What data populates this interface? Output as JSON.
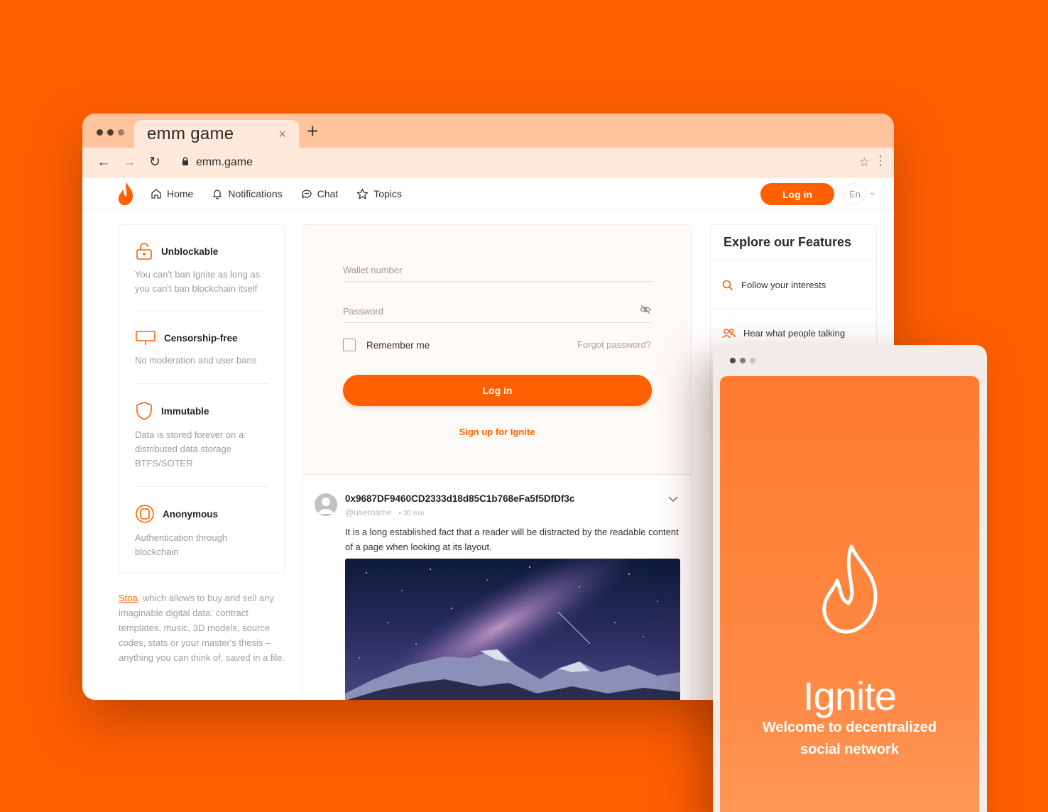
{
  "browser": {
    "tab_title": "emm game",
    "tab_close": "×",
    "new_tab": "+",
    "url": "emm.game"
  },
  "nav": {
    "items": [
      {
        "label": "Home",
        "icon": "home-icon"
      },
      {
        "label": "Notifications",
        "icon": "bell-icon"
      },
      {
        "label": "Chat",
        "icon": "chat-icon"
      },
      {
        "label": "Topics",
        "icon": "star-icon"
      }
    ],
    "login": "Log in",
    "lang": "En"
  },
  "features": [
    {
      "title": "Unblockable",
      "desc": "You can't ban Ignite as long as you can't ban blockchain itself",
      "icon": "padlock-icon"
    },
    {
      "title": "Censorship-free",
      "desc": "No moderation and user bans",
      "icon": "signboard-icon"
    },
    {
      "title": "Immutable",
      "desc": "Data is stored forever on a distributed data storage BTFS/SOTER",
      "icon": "shield-icon"
    },
    {
      "title": "Anonymous",
      "desc": "Authentication through blockchain",
      "icon": "mask-icon"
    }
  ],
  "stoa": {
    "link": "Stoa",
    "text": ", which allows to buy and sell any imaginable digital data: contract templates, music, 3D models, source codes, stats or your master's thesis – anything you can think of, saved in a file."
  },
  "login_form": {
    "wallet_placeholder": "Wallet number",
    "password_placeholder": "Password",
    "remember": "Remember me",
    "forgot": "Forgot password?",
    "submit": "Log in",
    "signup": "Sign up for Ignite"
  },
  "post": {
    "hash": "0x9687DF9460CD2333d18d85C1b768eFa5f5DfDf3c",
    "username": "@username",
    "time": "• 30 min",
    "text": "It is a long established fact that a reader will be distracted by the readable content of a page when looking at its layout."
  },
  "explore": {
    "title": "Explore our Features",
    "items": [
      {
        "label": "Follow your interests",
        "icon": "search-icon"
      },
      {
        "label": "Hear what people talking",
        "icon": "people-icon"
      }
    ]
  },
  "mobile": {
    "brand": "Ignite",
    "welcome": "Welcome to decentralized social network"
  },
  "colors": {
    "accent": "#ff5f00",
    "tab_strip": "#ffc49c",
    "tab_active": "#ffe9da"
  }
}
